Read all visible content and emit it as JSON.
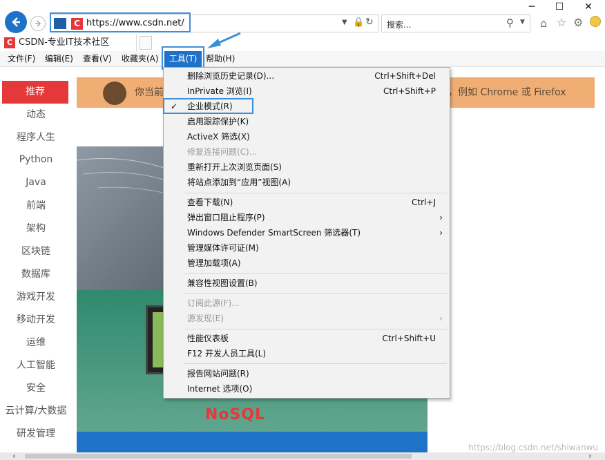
{
  "window": {
    "minimize": "─",
    "maximize": "☐",
    "close": "✕"
  },
  "address": {
    "url": "https://www.csdn.net/"
  },
  "search": {
    "placeholder": "搜索..."
  },
  "tab": {
    "title": "CSDN-专业IT技术社区"
  },
  "menubar": {
    "items": [
      "文件(F)",
      "编辑(E)",
      "查看(V)",
      "收藏夹(A)",
      "工具(T)",
      "帮助(H)"
    ]
  },
  "sidebar": {
    "items": [
      "推荐",
      "动态",
      "程序人生",
      "Python",
      "Java",
      "前端",
      "架构",
      "区块链",
      "数据库",
      "游戏开发",
      "移动开发",
      "运维",
      "人工智能",
      "安全",
      "云计算/大数据",
      "研发管理"
    ]
  },
  "banner": {
    "text": "你当前",
    "text_right": "器，例如 Chrome 或 Firefox"
  },
  "hero": {
    "label": "NoSQL"
  },
  "tools_menu": {
    "items": [
      {
        "label": "删除浏览历史记录(D)...",
        "shortcut": "Ctrl+Shift+Del"
      },
      {
        "label": "InPrivate 浏览(I)",
        "shortcut": "Ctrl+Shift+P"
      },
      {
        "label": "企业模式(R)",
        "checked": true
      },
      {
        "label": "启用跟踪保护(K)"
      },
      {
        "label": "ActiveX 筛选(X)"
      },
      {
        "label": "修复连接问题(C)...",
        "disabled": true
      },
      {
        "label": "重新打开上次浏览页面(S)"
      },
      {
        "label": "将站点添加到“应用”视图(A)"
      },
      {
        "label": "查看下载(N)",
        "shortcut": "Ctrl+J"
      },
      {
        "label": "弹出窗口阻止程序(P)",
        "submenu": true
      },
      {
        "label": "Windows Defender SmartScreen 筛选器(T)",
        "submenu": true
      },
      {
        "label": "管理媒体许可证(M)"
      },
      {
        "label": "管理加载项(A)"
      },
      {
        "label": "兼容性视图设置(B)"
      },
      {
        "label": "订阅此源(F)...",
        "disabled": true
      },
      {
        "label": "源发现(E)",
        "disabled": true,
        "submenu": true
      },
      {
        "label": "性能仪表板",
        "shortcut": "Ctrl+Shift+U"
      },
      {
        "label": "F12 开发人员工具(L)"
      },
      {
        "label": "报告网站问题(R)"
      },
      {
        "label": "Internet 选项(O)"
      }
    ]
  },
  "watermark": {
    "text": "https://blog.csdn.net/shiwanwu"
  },
  "colors": {
    "accent": "#3a8fd8",
    "csdn_red": "#e5383b",
    "banner": "#f0ae74"
  }
}
